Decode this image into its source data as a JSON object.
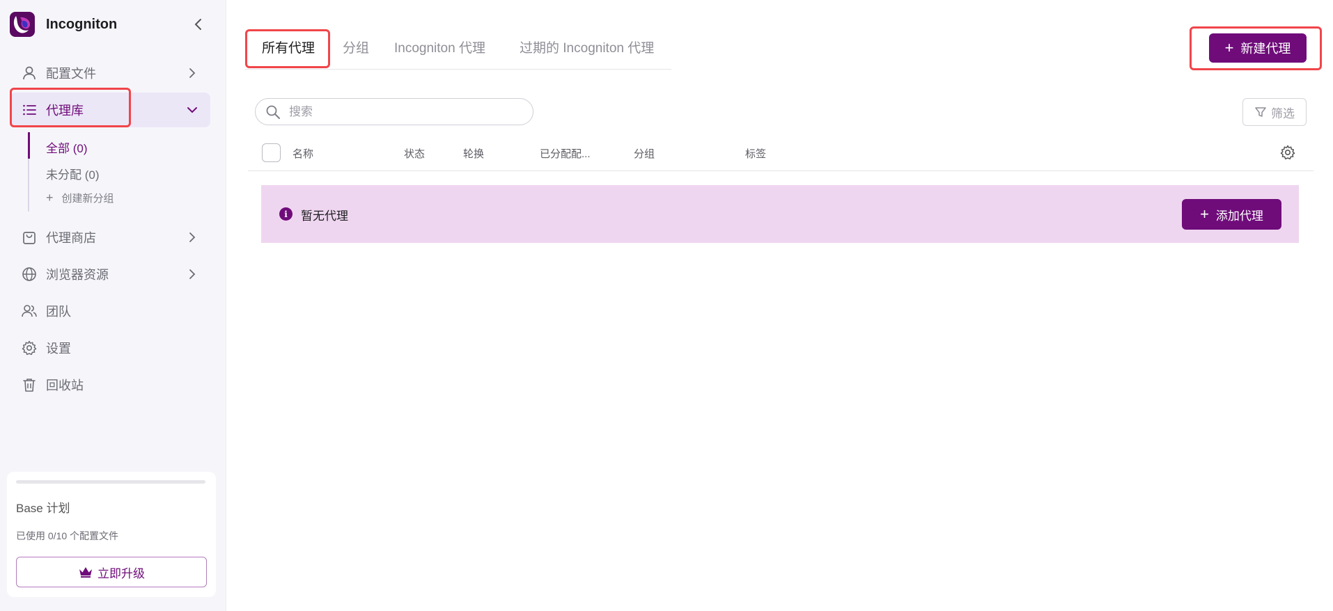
{
  "app": {
    "name": "Incogniton"
  },
  "sidebar": {
    "items": [
      {
        "label": "配置文件",
        "icon": "user-icon"
      },
      {
        "label": "代理库",
        "icon": "list-icon"
      },
      {
        "label": "代理商店",
        "icon": "shopping-bag-icon"
      },
      {
        "label": "浏览器资源",
        "icon": "globe-icon"
      },
      {
        "label": "团队",
        "icon": "users-icon"
      },
      {
        "label": "设置",
        "icon": "gear-icon"
      },
      {
        "label": "回收站",
        "icon": "trash-icon"
      }
    ],
    "subitems": [
      {
        "label": "全部 (0)"
      },
      {
        "label": "未分配 (0)"
      }
    ],
    "create_group_label": "创建新分组",
    "plan": {
      "title": "Base 计划",
      "usage": "已使用 0/10 个配置文件",
      "upgrade_label": "立即升级"
    }
  },
  "main": {
    "tabs": [
      {
        "label": "所有代理"
      },
      {
        "label": "分组"
      },
      {
        "label": "Incogniton 代理"
      },
      {
        "label": "过期的 Incogniton 代理"
      }
    ],
    "new_button_label": "新建代理",
    "search": {
      "placeholder": "搜索",
      "value": ""
    },
    "filter_label": "筛选",
    "table": {
      "columns": [
        "名称",
        "状态",
        "轮换",
        "已分配配...",
        "分组",
        "标签"
      ]
    },
    "empty": {
      "message": "暂无代理",
      "add_label": "添加代理"
    }
  },
  "colors": {
    "accent": "#6f0c7a",
    "banner": "#efd6f0",
    "highlight": "#f0454a"
  }
}
